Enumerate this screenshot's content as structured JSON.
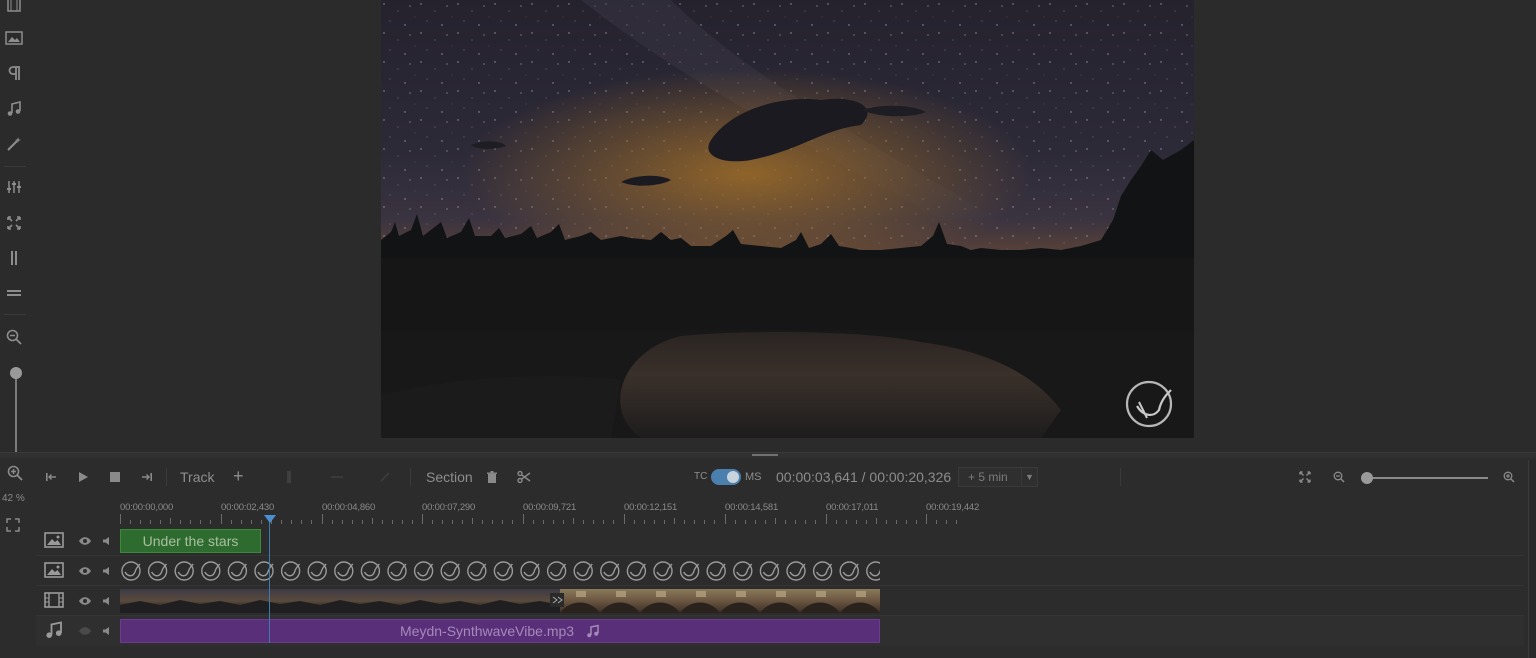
{
  "left_rail": {
    "icons": [
      "film-icon",
      "image-icon",
      "paragraph-icon",
      "music-note-icon",
      "magic-wand-icon",
      "sliders-icon",
      "fit-arrows-icon",
      "vertical-bars-icon",
      "horizontal-bars-icon",
      "zoom-out-icon"
    ]
  },
  "preview": {
    "scene": "night-sky-lake"
  },
  "timeline_side": {
    "zoom_percent": "42 %"
  },
  "toolbar": {
    "track_label": "Track",
    "add_label": "+",
    "section_label": "Section",
    "tc_label": "TC",
    "ms_label": "MS",
    "tc_enabled": true,
    "timecode": "00:00:03,641 / 00:00:20,326",
    "duration_select": "+ 5 min"
  },
  "ruler": {
    "ticks": [
      "00:00:00,000",
      "00:00:02,430",
      "00:00:04,860",
      "00:00:07,290",
      "00:00:09,721",
      "00:00:12,151",
      "00:00:14,581",
      "00:00:17,011",
      "00:00:19,442"
    ]
  },
  "tracks": [
    {
      "type": "image",
      "icon": "image-icon",
      "clip_label": "Under the stars",
      "clip_color": "#2e6b2e"
    },
    {
      "type": "image",
      "icon": "image-icon",
      "clip_label": "",
      "clip_color": "#2c2c2d"
    },
    {
      "type": "video",
      "icon": "film-icon",
      "clip_label": "",
      "clip_color": "#3a3836"
    },
    {
      "type": "audio",
      "icon": "music-note-icon",
      "clip_label": "Meydn-SynthwaveVibe.mp3",
      "clip_color": "#5a2f7a"
    }
  ],
  "colors": {
    "accent": "#4a8fcf",
    "background": "#2b2b2c"
  }
}
